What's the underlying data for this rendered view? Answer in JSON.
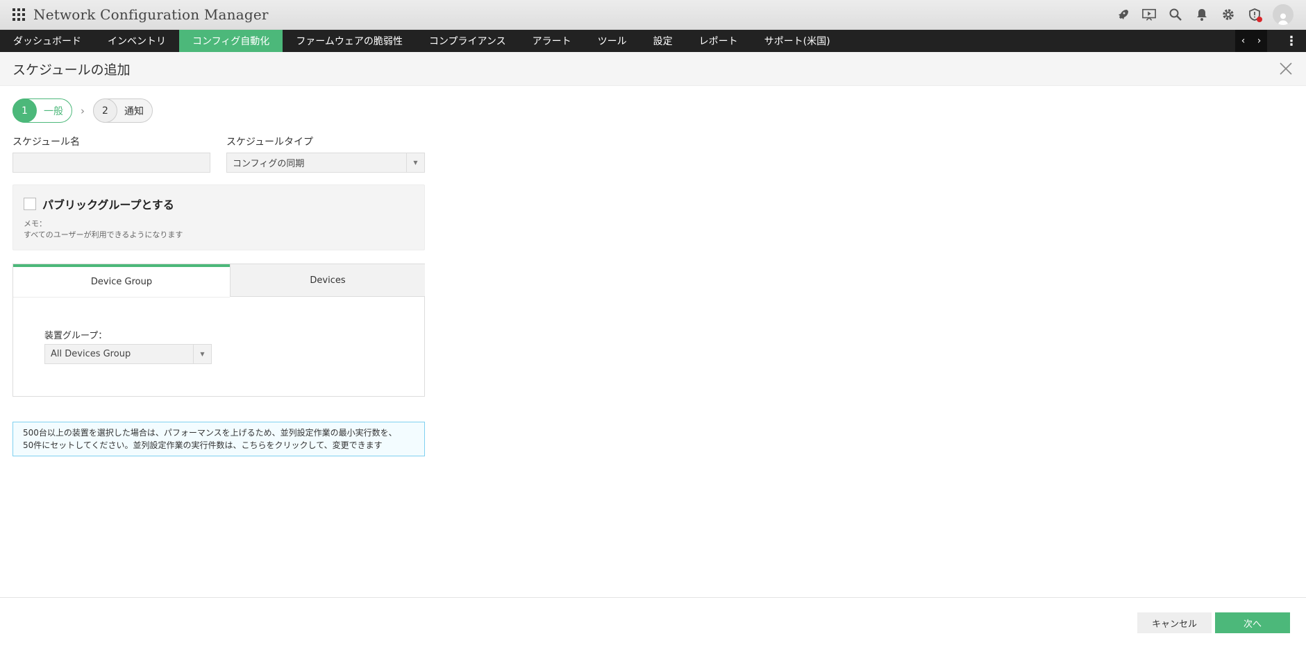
{
  "app": {
    "title": "Network Configuration Manager"
  },
  "nav": {
    "items": [
      "ダッシュボード",
      "インベントリ",
      "コンフィグ自動化",
      "ファームウェアの脆弱性",
      "コンプライアンス",
      "アラート",
      "ツール",
      "設定",
      "レポート",
      "サポート(米国)"
    ],
    "active_index": 2
  },
  "page": {
    "title": "スケジュールの追加"
  },
  "steps": [
    {
      "num": "1",
      "label": "一般"
    },
    {
      "num": "2",
      "label": "通知"
    }
  ],
  "form": {
    "schedule_name_label": "スケジュール名",
    "schedule_name_value": "",
    "schedule_type_label": "スケジュールタイプ",
    "schedule_type_value": "コンフィグの同期"
  },
  "public_group": {
    "label": "パブリックグループとする",
    "checked": false,
    "memo_title": "メモ：",
    "memo_text": "すべてのユーザーが利用できるようになります"
  },
  "tabs": {
    "device_group": "Device Group",
    "devices": "Devices",
    "device_group_label": "装置グループ：",
    "device_group_value": "All Devices Group"
  },
  "notice": {
    "line1": "500台以上の装置を選択した場合は、パフォーマンスを上げるため、並列設定作業の最小実行数を、",
    "line2": "50件にセットしてください。並列設定作業の実行件数は、こちらをクリックして、変更できます"
  },
  "footer": {
    "cancel": "キャンセル",
    "next": "次へ"
  },
  "colors": {
    "accent": "#4cb87a",
    "navbar": "#222222",
    "notice_border": "#7fd0f0"
  }
}
